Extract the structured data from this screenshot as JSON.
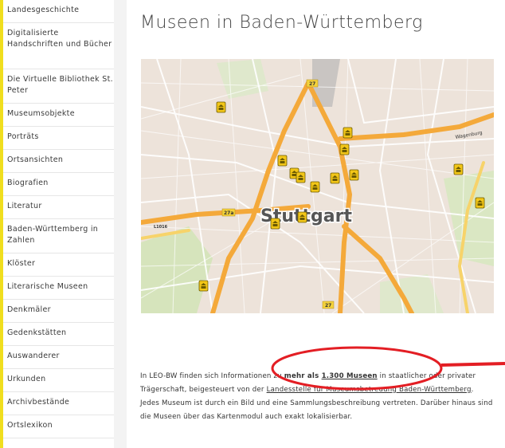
{
  "sidebar": {
    "items": [
      {
        "label": "Landesgeschichte"
      },
      {
        "label": "Digitalisierte Handschriften und Bücher"
      },
      {
        "label": "Die Virtuelle Bibliothek St. Peter"
      },
      {
        "label": "Museumsobjekte"
      },
      {
        "label": "Porträts"
      },
      {
        "label": "Ortsansichten"
      },
      {
        "label": "Biografien"
      },
      {
        "label": "Literatur"
      },
      {
        "label": "Baden-Württemberg in Zahlen"
      },
      {
        "label": "Klöster"
      },
      {
        "label": "Literarische Museen"
      },
      {
        "label": "Denkmäler"
      },
      {
        "label": "Gedenkstätten"
      },
      {
        "label": "Auswanderer"
      },
      {
        "label": "Urkunden"
      },
      {
        "label": "Archivbestände"
      },
      {
        "label": "Ortslexikon"
      }
    ]
  },
  "main": {
    "title": "Museen in Baden-Württemberg",
    "map": {
      "city_label": "Stuttgart",
      "road_labels": [
        "27",
        "27a",
        "27",
        "L1016"
      ],
      "street_label": "Wagenburg",
      "marker_color": "#f2c618",
      "road_color": "#f4a93a",
      "background_color": "#eee4dc"
    },
    "intro": {
      "part1": "In LEO-BW finden sich Informationen zu ",
      "bold1": "mehr als ",
      "link_count": "1.300 Museen",
      "part2": " in staatlicher oder privater Trägerschaft, beigesteuert von der ",
      "link_landesstelle": "Landesstelle für Museumsbetreuung Baden-Württemberg",
      "part3": ". Jedes Museum ist durch ein Bild und eine Sammlungsbeschreibung vertreten. Darüber hinaus sind die Museen über das Kartenmodul auch exakt lokalisierbar."
    }
  },
  "annotation": {
    "color": "#e31e24"
  }
}
